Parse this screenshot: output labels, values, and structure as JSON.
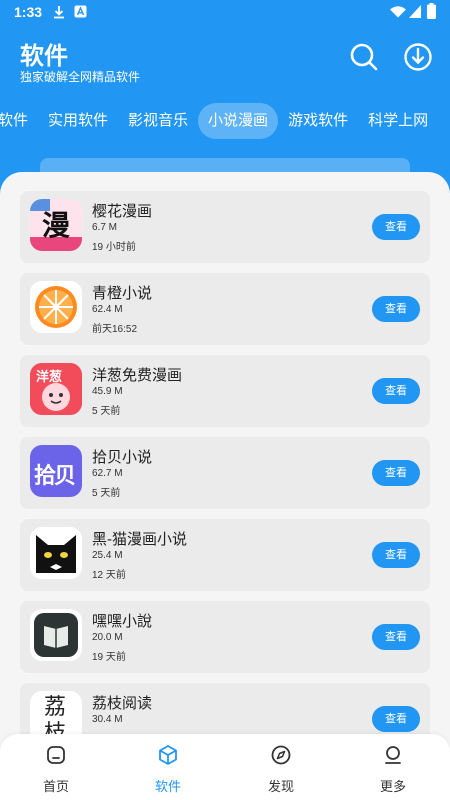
{
  "status": {
    "time": "1:33"
  },
  "header": {
    "title": "软件",
    "subtitle": "独家破解全网精品软件"
  },
  "tabs": [
    {
      "label": "软件"
    },
    {
      "label": "实用软件"
    },
    {
      "label": "影视音乐"
    },
    {
      "label": "小说漫画",
      "active": true
    },
    {
      "label": "游戏软件"
    },
    {
      "label": "科学上网"
    }
  ],
  "apps": [
    {
      "name": "樱花漫画",
      "size": "6.7 M",
      "time": "19 小时前",
      "button": "查看",
      "icon": "sakura-manga-icon",
      "icon_text": "漫"
    },
    {
      "name": "青橙小说",
      "size": "62.4 M",
      "time": "前天16:52",
      "button": "查看",
      "icon": "orange-slice-icon"
    },
    {
      "name": "洋葱免费漫画",
      "size": "45.9 M",
      "time": "5 天前",
      "button": "查看",
      "icon": "onion-manga-icon",
      "icon_text": "洋葱"
    },
    {
      "name": "拾贝小说",
      "size": "62.7 M",
      "time": "5 天前",
      "button": "查看",
      "icon": "shibei-icon",
      "icon_text": "拾贝"
    },
    {
      "name": "黑-猫漫画小说",
      "size": "25.4 M",
      "time": "12 天前",
      "button": "查看",
      "icon": "black-cat-icon"
    },
    {
      "name": "嘿嘿小說",
      "size": "20.0 M",
      "time": "19 天前",
      "button": "查看",
      "icon": "book-icon"
    },
    {
      "name": "荔枝阅读",
      "size": "30.4 M",
      "time": "",
      "button": "查看",
      "icon": "lizhi-icon",
      "icon_text": "荔枝"
    }
  ],
  "bottom_nav": [
    {
      "label": "首页",
      "icon": "home-icon"
    },
    {
      "label": "软件",
      "icon": "cube-icon",
      "active": true
    },
    {
      "label": "发现",
      "icon": "compass-icon"
    },
    {
      "label": "更多",
      "icon": "person-icon"
    }
  ],
  "colors": {
    "primary": "#2196F3",
    "sheet": "#F5F5F5",
    "card": "#EBEBEB"
  }
}
